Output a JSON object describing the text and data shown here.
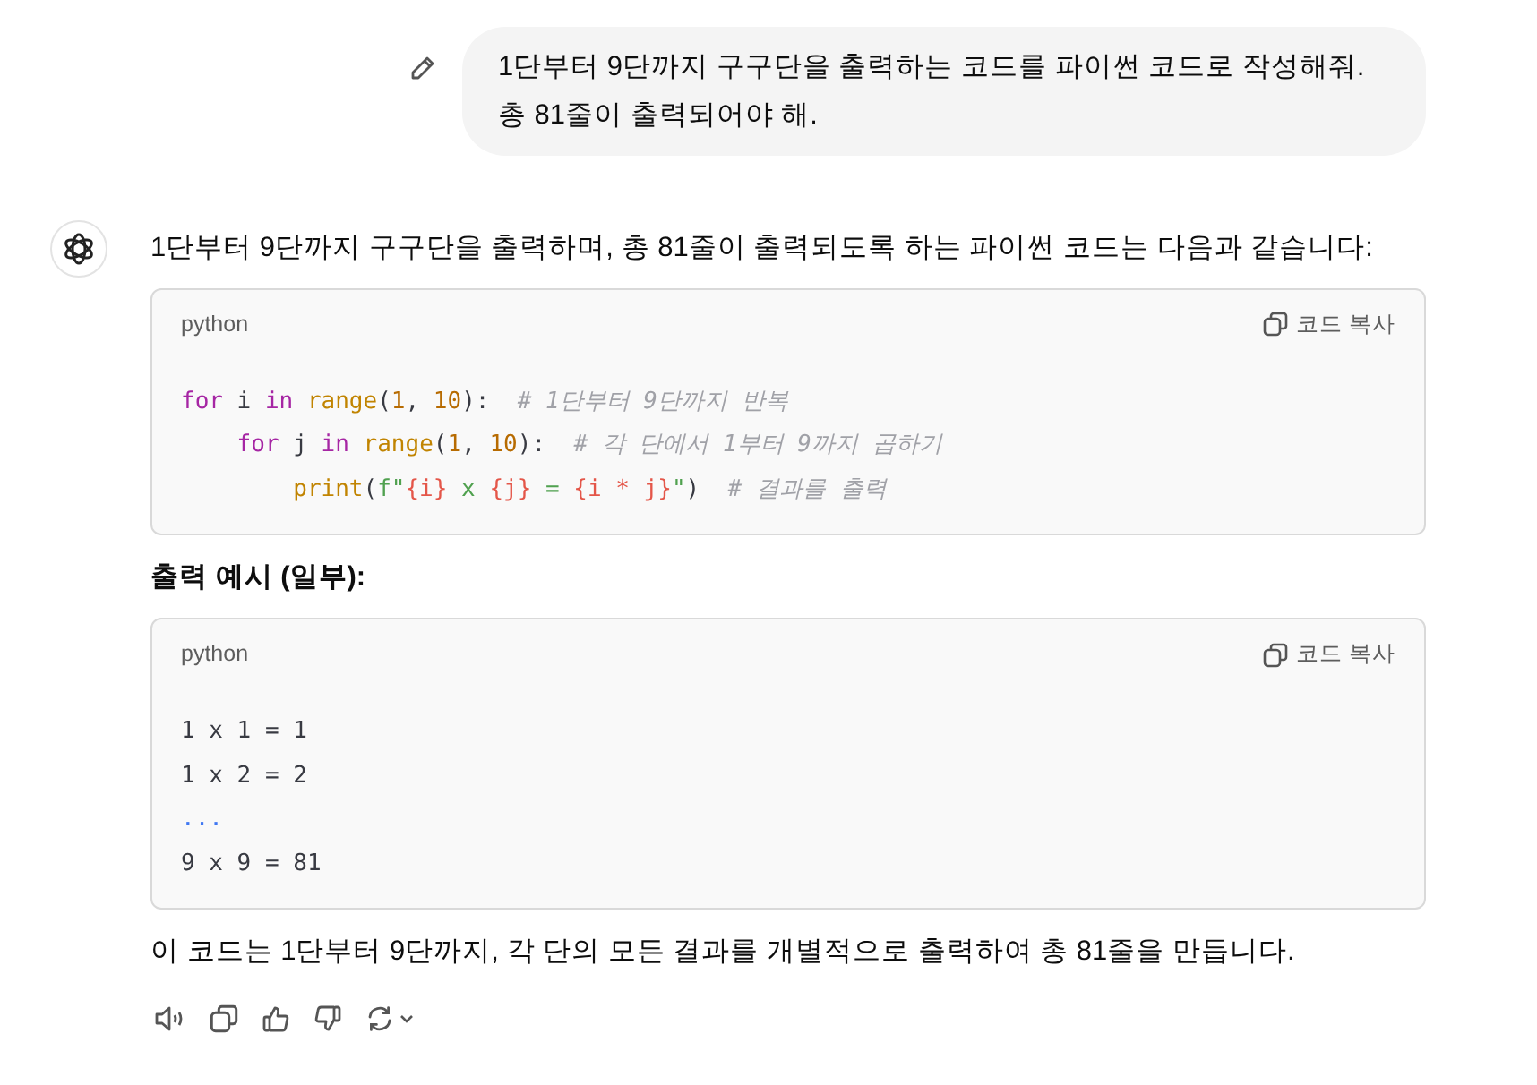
{
  "user_message": {
    "text": "1단부터 9단까지 구구단을 출력하는 코드를 파이썬 코드로 작성해줘.\n총 81줄이 출력되어야 해."
  },
  "assistant": {
    "intro": "1단부터 9단까지 구구단을 출력하며, 총 81줄이 출력되도록 하는 파이썬 코드는 다음과 같습니다:",
    "blocks": [
      {
        "kind": "code",
        "language": "python",
        "copy_label": "코드 복사",
        "lines": [
          [
            {
              "kind": "keyword",
              "text": "for"
            },
            {
              "kind": "plain",
              "text": " i "
            },
            {
              "kind": "keyword",
              "text": "in "
            },
            {
              "kind": "builtin",
              "text": "range"
            },
            {
              "kind": "plain",
              "text": "("
            },
            {
              "kind": "number",
              "text": "1"
            },
            {
              "kind": "plain",
              "text": ", "
            },
            {
              "kind": "number",
              "text": "10"
            },
            {
              "kind": "plain",
              "text": "):  "
            },
            {
              "kind": "comment",
              "text": "# 1단부터 9단까지 반복"
            }
          ],
          [
            {
              "kind": "keyword",
              "text": "    for"
            },
            {
              "kind": "plain",
              "text": " j "
            },
            {
              "kind": "keyword",
              "text": "in "
            },
            {
              "kind": "builtin",
              "text": "range"
            },
            {
              "kind": "plain",
              "text": "("
            },
            {
              "kind": "number",
              "text": "1"
            },
            {
              "kind": "plain",
              "text": ", "
            },
            {
              "kind": "number",
              "text": "10"
            },
            {
              "kind": "plain",
              "text": "):  "
            },
            {
              "kind": "comment",
              "text": "# 각 단에서 1부터 9까지 곱하기"
            }
          ],
          [
            {
              "kind": "builtin",
              "text": "        print"
            },
            {
              "kind": "plain",
              "text": "("
            },
            {
              "kind": "string",
              "text": "f\""
            },
            {
              "kind": "interp",
              "text": "{i}"
            },
            {
              "kind": "string",
              "text": " x "
            },
            {
              "kind": "interp",
              "text": "{j}"
            },
            {
              "kind": "string",
              "text": " = "
            },
            {
              "kind": "interp",
              "text": "{i * j}"
            },
            {
              "kind": "string",
              "text": "\""
            },
            {
              "kind": "plain",
              "text": ")  "
            },
            {
              "kind": "comment",
              "text": "# 결과를 출력"
            }
          ]
        ]
      },
      {
        "kind": "heading",
        "text": "출력 예시 (일부):"
      },
      {
        "kind": "code",
        "language": "python",
        "copy_label": "코드 복사",
        "lines": [
          [
            {
              "kind": "plain",
              "text": "1 x 1 = 1"
            }
          ],
          [
            {
              "kind": "plain",
              "text": "1 x 2 = 2"
            }
          ],
          [
            {
              "kind": "operator",
              "text": "..."
            }
          ],
          [
            {
              "kind": "plain",
              "text": "9 x 9 = 81"
            }
          ]
        ]
      },
      {
        "kind": "paragraph",
        "text": "이 코드는 1단부터 9단까지, 각 단의 모든 결과를 개별적으로 출력하여 총 81줄을 만듭니다."
      }
    ]
  }
}
